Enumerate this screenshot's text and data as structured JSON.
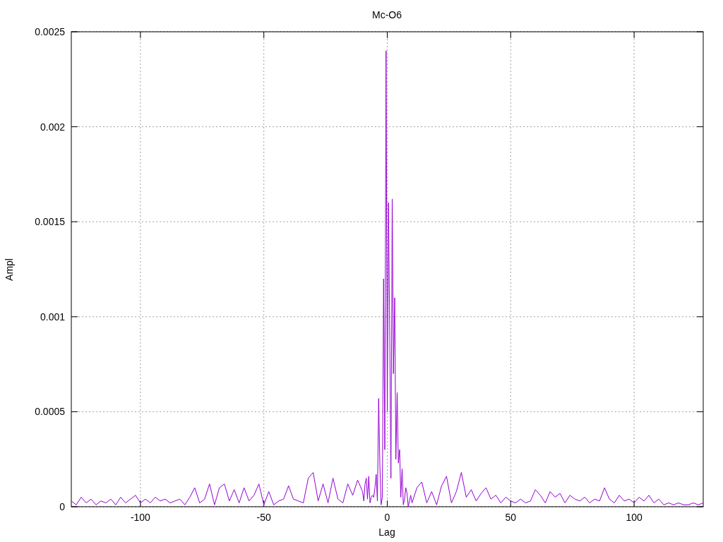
{
  "chart_data": {
    "type": "line",
    "grid": true,
    "title": "Mc-O6",
    "xlabel": "Lag",
    "ylabel": "Ampl",
    "xlim": [
      -128,
      128
    ],
    "ylim": [
      0,
      0.0025
    ],
    "xticks": [
      -100,
      -50,
      0,
      50,
      100
    ],
    "yticks": [
      {
        "value": 0,
        "label": "0"
      },
      {
        "value": 0.0005,
        "label": "0.0005"
      },
      {
        "value": 0.001,
        "label": "0.001"
      },
      {
        "value": 0.0015,
        "label": "0.0015"
      },
      {
        "value": 0.002,
        "label": "0.002"
      },
      {
        "value": 0.0025,
        "label": "0.0025"
      }
    ],
    "x": [
      -128,
      -126,
      -124,
      -122,
      -120,
      -118,
      -116,
      -114,
      -112,
      -110,
      -108,
      -106,
      -104,
      -102,
      -100,
      -98,
      -96,
      -94,
      -92,
      -90,
      -88,
      -86,
      -84,
      -82,
      -80,
      -78,
      -76,
      -74,
      -72,
      -70,
      -68,
      -66,
      -64,
      -62,
      -60,
      -58,
      -56,
      -54,
      -52,
      -50,
      -48,
      -46,
      -44,
      -42,
      -40,
      -38,
      -36,
      -34,
      -32,
      -30,
      -28,
      -26,
      -24,
      -22,
      -20,
      -18,
      -16,
      -14,
      -12,
      -10,
      -9.5,
      -9,
      -8.5,
      -8,
      -7.5,
      -7,
      -6.5,
      -6,
      -5.5,
      -5,
      -4.5,
      -4,
      -3.5,
      -3,
      -2.5,
      -2,
      -1.5,
      -1,
      -0.5,
      0,
      0.5,
      1,
      1.5,
      2,
      2.5,
      3,
      3.5,
      4,
      4.5,
      5,
      5.5,
      6,
      6.5,
      7,
      7.5,
      8,
      8.5,
      9,
      9.5,
      10,
      12,
      14,
      16,
      18,
      20,
      22,
      24,
      26,
      28,
      30,
      32,
      34,
      36,
      38,
      40,
      42,
      44,
      46,
      48,
      50,
      52,
      54,
      56,
      58,
      60,
      62,
      64,
      66,
      68,
      70,
      72,
      74,
      76,
      78,
      80,
      82,
      84,
      86,
      88,
      90,
      92,
      94,
      96,
      98,
      100,
      102,
      104,
      106,
      108,
      110,
      112,
      114,
      116,
      118,
      120,
      122,
      124,
      126,
      128
    ],
    "series": [
      {
        "color": "#9400d3",
        "values": [
          3e-05,
          1e-05,
          5e-05,
          2e-05,
          4e-05,
          1e-05,
          3e-05,
          2e-05,
          4e-05,
          1e-05,
          5e-05,
          2e-05,
          4e-05,
          6e-05,
          2e-05,
          4e-05,
          2e-05,
          5e-05,
          3e-05,
          4e-05,
          2e-05,
          3e-05,
          4e-05,
          1e-05,
          5e-05,
          0.0001,
          2e-05,
          4e-05,
          0.00012,
          1e-05,
          0.0001,
          0.00012,
          3e-05,
          9e-05,
          2e-05,
          0.0001,
          3e-05,
          6e-05,
          0.00012,
          1e-05,
          8e-05,
          1e-05,
          3e-05,
          4e-05,
          0.00011,
          4e-05,
          3e-05,
          2e-05,
          0.00015,
          0.00018,
          3e-05,
          0.00012,
          2e-05,
          0.00015,
          4e-05,
          2e-05,
          0.00012,
          6e-05,
          0.00014,
          8e-05,
          3e-05,
          0.00012,
          0.00015,
          4e-05,
          0.00016,
          2e-05,
          5e-05,
          6e-05,
          5e-05,
          0.0001,
          0.00017,
          3e-05,
          0.00057,
          0.00022,
          1e-05,
          5e-05,
          0.0012,
          0.0003,
          0.0024,
          0.0005,
          0.0016,
          0.0009,
          0.00015,
          0.00162,
          0.0007,
          0.0011,
          0.00025,
          0.0006,
          0.00023,
          0.0003,
          5e-05,
          0.0002,
          1e-05,
          4e-05,
          0.0001,
          7e-05,
          0,
          3e-05,
          6e-05,
          2e-05,
          0.0001,
          0.00013,
          2e-05,
          8e-05,
          1e-05,
          0.00011,
          0.00016,
          2e-05,
          8e-05,
          0.00018,
          5e-05,
          9e-05,
          3e-05,
          7e-05,
          0.0001,
          4e-05,
          6e-05,
          2e-05,
          5e-05,
          3e-05,
          2e-05,
          4e-05,
          2e-05,
          3e-05,
          9e-05,
          6e-05,
          2e-05,
          8e-05,
          5e-05,
          7e-05,
          2e-05,
          6e-05,
          4e-05,
          3e-05,
          5e-05,
          2e-05,
          4e-05,
          3e-05,
          0.0001,
          4e-05,
          2e-05,
          6e-05,
          3e-05,
          4e-05,
          2e-05,
          5e-05,
          3e-05,
          6e-05,
          2e-05,
          4e-05,
          1e-05,
          2e-05,
          1e-05,
          2e-05,
          1e-05,
          1e-05,
          2e-05,
          1e-05,
          2e-05
        ]
      }
    ]
  }
}
